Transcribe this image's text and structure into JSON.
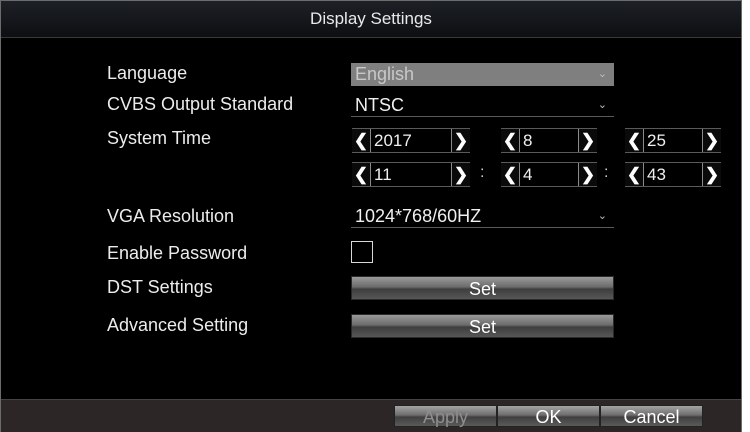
{
  "dialog": {
    "title": "Display Settings"
  },
  "fields": {
    "language": {
      "label": "Language",
      "value": "English"
    },
    "cvbs": {
      "label": "CVBS Output Standard",
      "value": "NTSC"
    },
    "system_time": {
      "label": "System Time",
      "year": "2017",
      "month": "8",
      "day": "25",
      "hour": "11",
      "minute": "4",
      "second": "43",
      "separator": ":"
    },
    "vga": {
      "label": "VGA Resolution",
      "value": "1024*768/60HZ"
    },
    "enable_password": {
      "label": "Enable Password",
      "checked": false
    },
    "dst": {
      "label": "DST Settings",
      "button": "Set"
    },
    "advanced": {
      "label": "Advanced Setting",
      "button": "Set"
    }
  },
  "footer": {
    "apply": "Apply",
    "ok": "OK",
    "cancel": "Cancel"
  },
  "icons": {
    "prev": "chevron-left-icon",
    "next": "chevron-right-icon",
    "dropdown": "chevron-down-icon"
  }
}
